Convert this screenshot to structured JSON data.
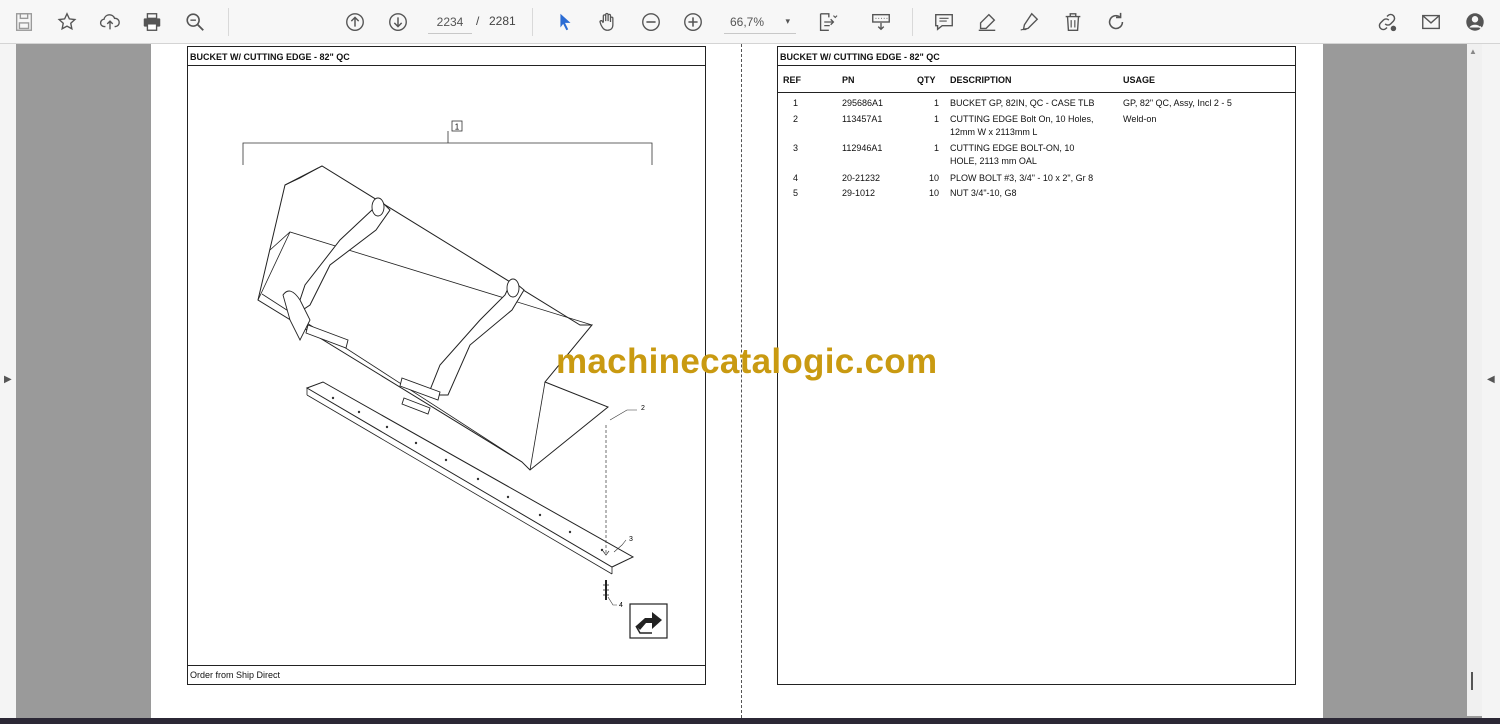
{
  "toolbar": {
    "icons": [
      "save-icon",
      "star-icon",
      "upload-icon",
      "print-icon",
      "zoom-search-icon",
      "page-up-icon",
      "page-down-icon",
      "select-cursor-icon",
      "hand-icon",
      "zoom-out-icon",
      "zoom-in-icon",
      "fit-page-icon",
      "scroll-mode-icon",
      "comment-icon",
      "highlight-icon",
      "sign-icon",
      "delete-icon",
      "rotate-icon",
      "share-link-icon",
      "mail-icon",
      "account-icon"
    ],
    "current_page": "2234",
    "page_separator": "/",
    "total_pages": "2281",
    "zoom_value": "66,7%",
    "zoom_caret": "▾"
  },
  "left_page": {
    "title": "BUCKET W/ CUTTING EDGE - 82\" QC",
    "footer": "Order from Ship Direct",
    "callouts": [
      "1",
      "2",
      "3",
      "4"
    ]
  },
  "right_page": {
    "title": "BUCKET W/ CUTTING EDGE - 82\" QC",
    "headers": {
      "ref": "REF",
      "pn": "PN",
      "qty": "QTY",
      "description": "DESCRIPTION",
      "usage": "USAGE"
    },
    "rows": [
      {
        "ref": "1",
        "pn": "295686A1",
        "qty": "1",
        "desc1": "BUCKET GP, 82IN, QC - CASE TLB",
        "desc2": "",
        "usage": "GP, 82\" QC, Assy, Incl 2 - 5"
      },
      {
        "ref": "2",
        "pn": "113457A1",
        "qty": "1",
        "desc1": "CUTTING EDGE Bolt On, 10 Holes,",
        "desc2": "12mm W x 2113mm L",
        "usage": "Weld-on"
      },
      {
        "ref": "3",
        "pn": "112946A1",
        "qty": "1",
        "desc1": "CUTTING EDGE BOLT-ON, 10",
        "desc2": "HOLE, 2113 mm OAL",
        "usage": ""
      },
      {
        "ref": "4",
        "pn": "20-21232",
        "qty": "10",
        "desc1": "PLOW BOLT #3, 3/4\" - 10 x 2\", Gr 8",
        "desc2": "",
        "usage": ""
      },
      {
        "ref": "5",
        "pn": "29-1012",
        "qty": "10",
        "desc1": "NUT 3/4\"-10, G8",
        "desc2": "",
        "usage": ""
      }
    ]
  },
  "watermark": "machinecatalogic.com",
  "colors": {
    "watermark": "#c99a11",
    "toolbar_bg": "#f7f7f7",
    "viewer_bg": "#9a9a9a",
    "cursor_blue": "#2b6cd4"
  }
}
